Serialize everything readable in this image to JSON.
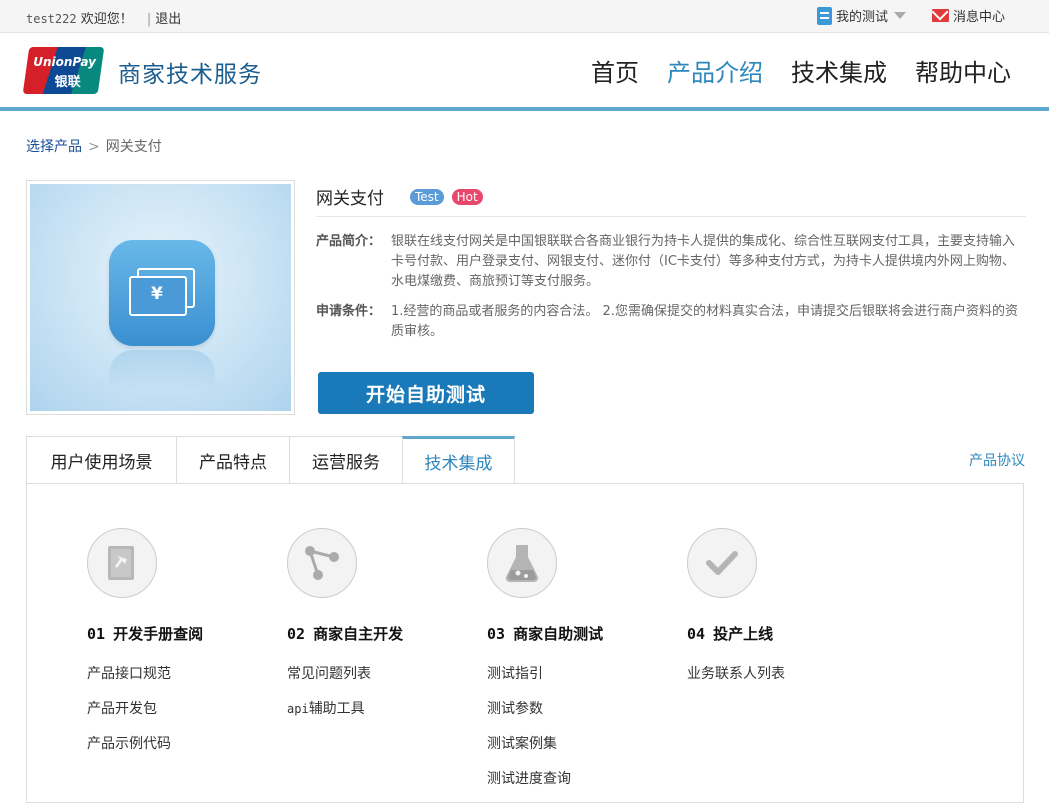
{
  "topbar": {
    "user": "test222",
    "welcome": "欢迎您！",
    "logout": "退出",
    "my_test": "我的测试",
    "messages": "消息中心"
  },
  "header": {
    "logo_text_top": "UnionPay",
    "logo_text_bottom": "银联",
    "brand": "商家技术服务",
    "nav": [
      "首页",
      "产品介绍",
      "技术集成",
      "帮助中心"
    ],
    "active_nav": "产品介绍"
  },
  "breadcrumb": {
    "root": "选择产品",
    "separator": ">",
    "current": "网关支付"
  },
  "product": {
    "name": "网关支付",
    "tags": [
      "Test",
      "Hot"
    ],
    "intro_label": "产品简介：",
    "intro": "银联在线支付网关是中国银联联合各商业银行为持卡人提供的集成化、综合性互联网支付工具，主要支持输入卡号付款、用户登录支付、网银支付、迷你付（IC卡支付）等多种支付方式，为持卡人提供境内外网上购物、水电煤缴费、商旅预订等支付服务。",
    "cond_label": "申请条件：",
    "cond": "1.经营的商品或者服务的内容合法。 2.您需确保提交的材料真实合法，申请提交后银联将会进行商户资料的资质审核。",
    "start_button": "开始自助测试",
    "icon_symbol": "¥"
  },
  "tabs": {
    "items": [
      "用户使用场景",
      "产品特点",
      "运营服务",
      "技术集成"
    ],
    "active": "技术集成",
    "agreement": "产品协议"
  },
  "steps": [
    {
      "num": "01",
      "title": "开发手册查阅",
      "icon": "manual-icon",
      "links": [
        "产品接口规范",
        "产品开发包",
        "产品示例代码"
      ]
    },
    {
      "num": "02",
      "title": "商家自主开发",
      "icon": "share-nodes-icon",
      "links_prefix": "api",
      "links": [
        "常见问题列表",
        "辅助工具"
      ]
    },
    {
      "num": "03",
      "title": "商家自助测试",
      "icon": "flask-icon",
      "links": [
        "测试指引",
        "测试参数",
        "测试案例集",
        "测试进度查询"
      ]
    },
    {
      "num": "04",
      "title": "投产上线",
      "icon": "check-icon",
      "links": [
        "业务联系人列表"
      ]
    }
  ]
}
